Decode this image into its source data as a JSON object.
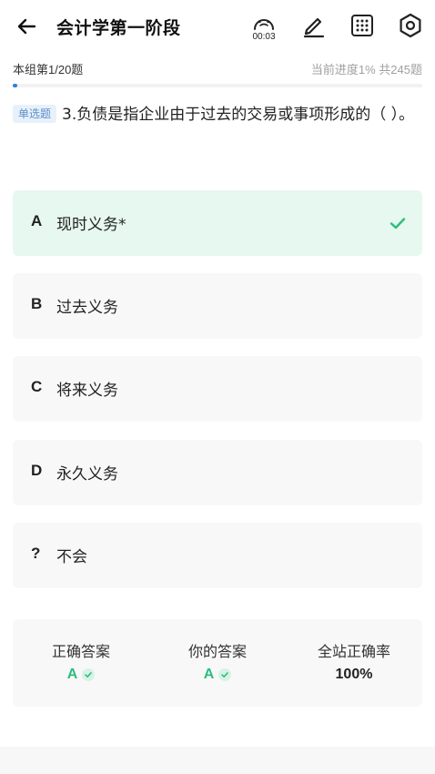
{
  "header": {
    "title": "会计学第一阶段",
    "timer": "00:03",
    "icons": [
      "back-arrow-icon",
      "timer-icon",
      "pencil-icon",
      "grid-icon",
      "gear-icon"
    ]
  },
  "progress": {
    "group_label": "本组第1/20题",
    "progress_text": "当前进度1%",
    "total_text": "共245题",
    "percent": 1
  },
  "question": {
    "type_badge": "单选题",
    "text": "3.负债是指企业由于过去的交易或事项形成的（ ）。"
  },
  "options": [
    {
      "letter": "A",
      "text": "现时义务*",
      "state": "correct"
    },
    {
      "letter": "B",
      "text": "过去义务",
      "state": "normal"
    },
    {
      "letter": "C",
      "text": "将来义务",
      "state": "normal"
    },
    {
      "letter": "D",
      "text": "永久义务",
      "state": "normal"
    },
    {
      "letter": "?",
      "text": "不会",
      "state": "normal"
    }
  ],
  "result": {
    "correct_answer_label": "正确答案",
    "correct_answer_value": "A",
    "your_answer_label": "你的答案",
    "your_answer_value": "A",
    "rate_label": "全站正确率",
    "rate_value": "100%"
  },
  "colors": {
    "accent_green": "#2bbd7e",
    "correct_bg": "#e6f8ef",
    "progress_blue": "#2f7fe0",
    "badge_bg": "#e8f1fb",
    "badge_text": "#5b8fc8"
  }
}
